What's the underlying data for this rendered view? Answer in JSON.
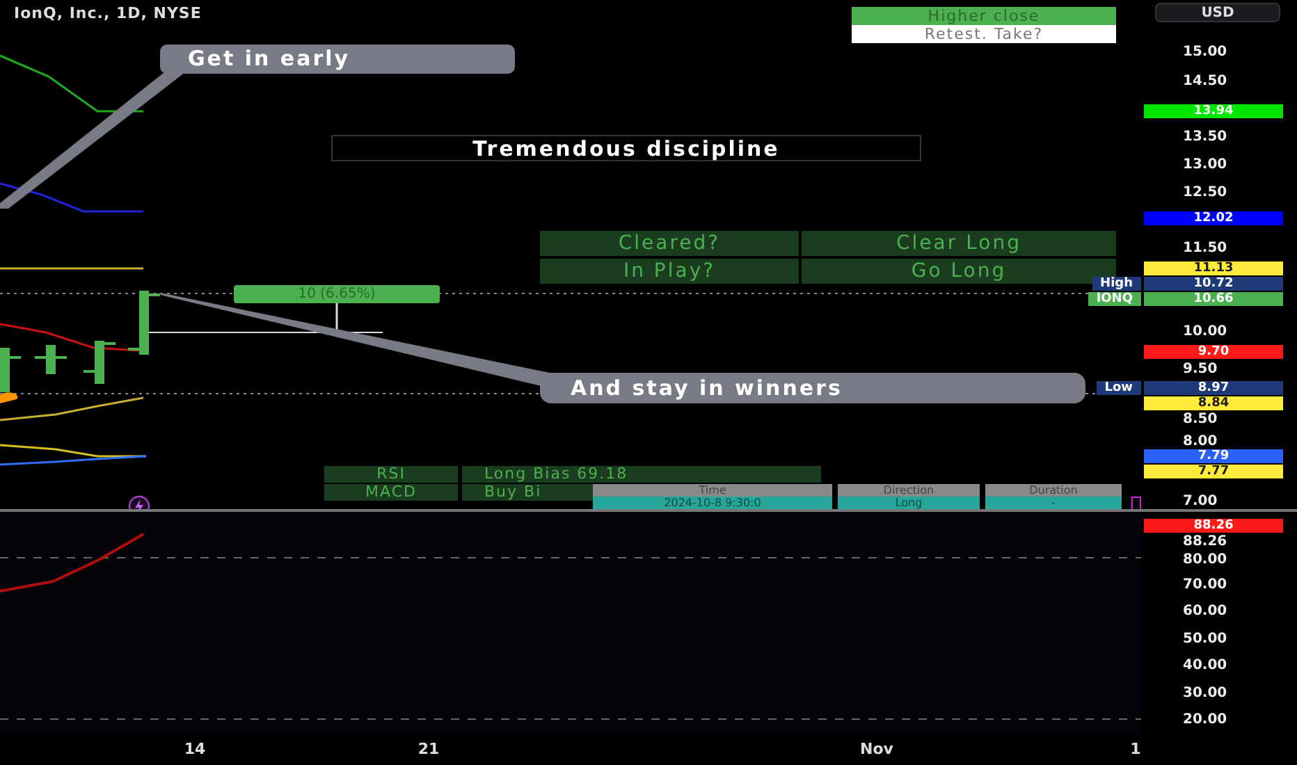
{
  "chart": {
    "title": "IonQ, Inc., 1D, NYSE"
  },
  "signal_table": {
    "rows": [
      {
        "text": "Higher close",
        "kind": "highlight"
      },
      {
        "text": "Retest. Take?",
        "kind": "plain"
      }
    ]
  },
  "callouts": [
    {
      "text": "Get in early"
    },
    {
      "text": "And stay in winners"
    }
  ],
  "note": "Tremendous discipline",
  "status_table": {
    "rows": [
      [
        "Cleared?",
        "Clear Long"
      ],
      [
        "In Play?",
        "Go Long"
      ]
    ]
  },
  "measure": {
    "label": "10 (6.65%)"
  },
  "bias_table": {
    "rows": [
      [
        "RSI",
        "Long Bias 69.18"
      ],
      [
        "MACD",
        "Buy Bi"
      ]
    ]
  },
  "trade_table": {
    "columns": [
      "Time",
      "Direction",
      "Duration"
    ],
    "row": [
      "2024-10-8 9:30:0",
      "Long",
      "-"
    ]
  },
  "price_axis": {
    "currency": "USD",
    "ticks": [
      "15.00",
      "14.50",
      "13.50",
      "13.00",
      "12.50",
      "11.50",
      "10.00",
      "9.50",
      "8.50",
      "8.00",
      "7.00"
    ],
    "markers": [
      {
        "value": "13.94",
        "color": "#00e600"
      },
      {
        "value": "12.02",
        "color": "#0000ff"
      },
      {
        "value": "11.13",
        "color": "#ffeb3b"
      },
      {
        "label": "High",
        "value": "10.72",
        "color": "#1e3a78"
      },
      {
        "label": "IONQ",
        "value": "10.66",
        "color": "#4caf50"
      },
      {
        "value": "9.70",
        "color": "#ff1a1a"
      },
      {
        "label": "Low",
        "value": "8.97",
        "color": "#1e3a78"
      },
      {
        "value": "8.84",
        "color": "#ffeb3b"
      },
      {
        "value": "7.79",
        "color": "#2962ff"
      },
      {
        "value": "7.77",
        "color": "#ffeb3b"
      }
    ]
  },
  "oscillator_axis": {
    "ticks": [
      "88.26",
      "80.00",
      "70.00",
      "60.00",
      "50.00",
      "40.00",
      "30.00",
      "20.00"
    ],
    "markers": [
      {
        "value": "88.26",
        "color": "#ff1a1a"
      }
    ]
  },
  "time_axis": {
    "labels": [
      "14",
      "21",
      "Nov",
      "1"
    ]
  }
}
